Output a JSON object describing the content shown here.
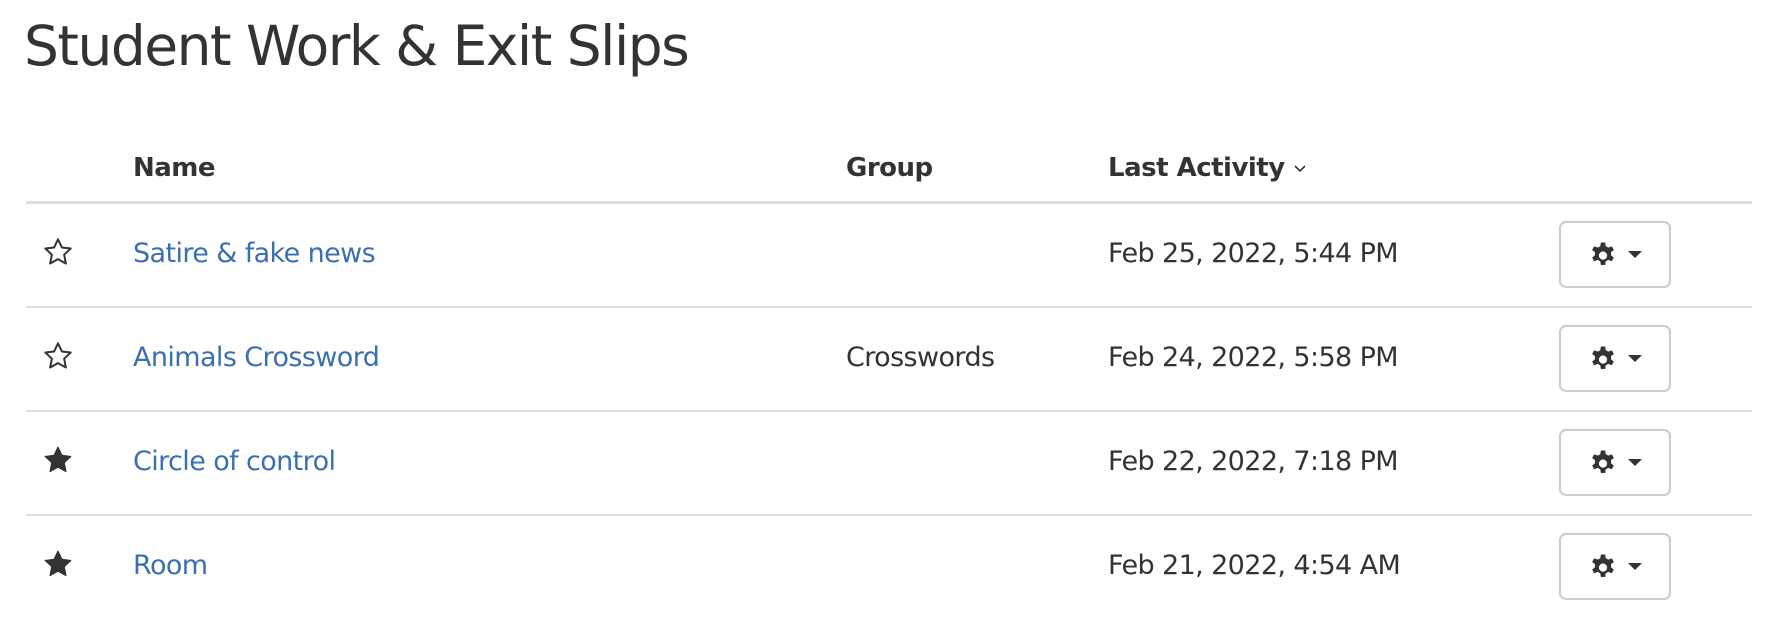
{
  "page": {
    "title": "Student Work & Exit Slips"
  },
  "table": {
    "columns": {
      "name": "Name",
      "group": "Group",
      "last_activity": "Last Activity"
    },
    "sort": {
      "column": "last_activity",
      "direction": "descending",
      "icon": "chevron-down-icon"
    },
    "rows": [
      {
        "starred": false,
        "name": "Satire & fake news",
        "group": "",
        "last_activity": "Feb 25, 2022, 5:44 PM",
        "actions_icon": "gear-icon"
      },
      {
        "starred": false,
        "name": "Animals Crossword",
        "group": "Crosswords",
        "last_activity": "Feb 24, 2022, 5:58 PM",
        "actions_icon": "gear-icon"
      },
      {
        "starred": true,
        "name": "Circle of control",
        "group": "",
        "last_activity": "Feb 22, 2022, 7:18 PM",
        "actions_icon": "gear-icon"
      },
      {
        "starred": true,
        "name": "Room",
        "group": "",
        "last_activity": "Feb 21, 2022, 4:54 AM",
        "actions_icon": "gear-icon"
      }
    ]
  },
  "colors": {
    "text": "#333333",
    "link": "#3a70b0",
    "divider": "#dddddd",
    "button_border": "#cccccc"
  }
}
